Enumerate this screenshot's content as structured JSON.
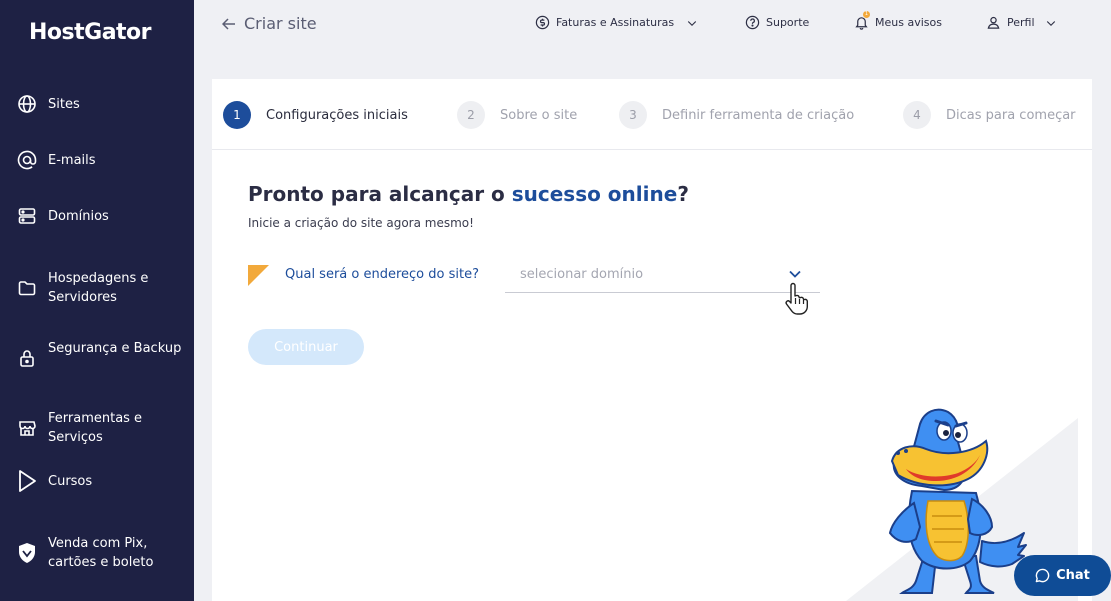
{
  "brand": {
    "logo_text": "HostGator"
  },
  "sidebar": {
    "items": [
      {
        "label": "Sites",
        "icon": "globe-icon"
      },
      {
        "label": "E-mails",
        "icon": "at-icon"
      },
      {
        "label": "Domínios",
        "icon": "server-icon"
      },
      {
        "label": "Hospedagens e Servidores",
        "icon": "folder-icon"
      },
      {
        "label": "Segurança e Backup",
        "icon": "lock-icon"
      },
      {
        "label": "Ferramentas e Serviços",
        "icon": "store-icon"
      },
      {
        "label": "Cursos",
        "icon": "play-icon"
      },
      {
        "label": "Venda com Pix, cartões e boleto",
        "icon": "shield-icon"
      }
    ]
  },
  "topbar": {
    "back_label": "Criar site",
    "billing_label": "Faturas e Assinaturas",
    "support_label": "Suporte",
    "notices_label": "Meus avisos",
    "notices_badge": "1",
    "profile_label": "Perfil"
  },
  "stepper": {
    "steps": [
      {
        "number": "1",
        "label": "Configurações iniciais",
        "active": true
      },
      {
        "number": "2",
        "label": "Sobre o site",
        "active": false
      },
      {
        "number": "3",
        "label": "Definir ferramenta de criação",
        "active": false
      },
      {
        "number": "4",
        "label": "Dicas para começar",
        "active": false
      }
    ]
  },
  "main": {
    "heading_part1": "Pronto para alcançar o ",
    "heading_accent": "sucesso online",
    "heading_part2": "?",
    "subheading": "Inicie a criação do site agora mesmo!",
    "question": "Qual será o endereço do site?",
    "domain_select_placeholder": "selecionar domínio",
    "continue_label": "Continuar"
  },
  "chat": {
    "label": "Chat"
  },
  "colors": {
    "sidebar_bg": "#1e2144",
    "accent_blue": "#1d4d9b",
    "flag_orange": "#f2a93b",
    "continue_disabled": "#d4e8fb",
    "chat_bg": "#0f4c96"
  }
}
